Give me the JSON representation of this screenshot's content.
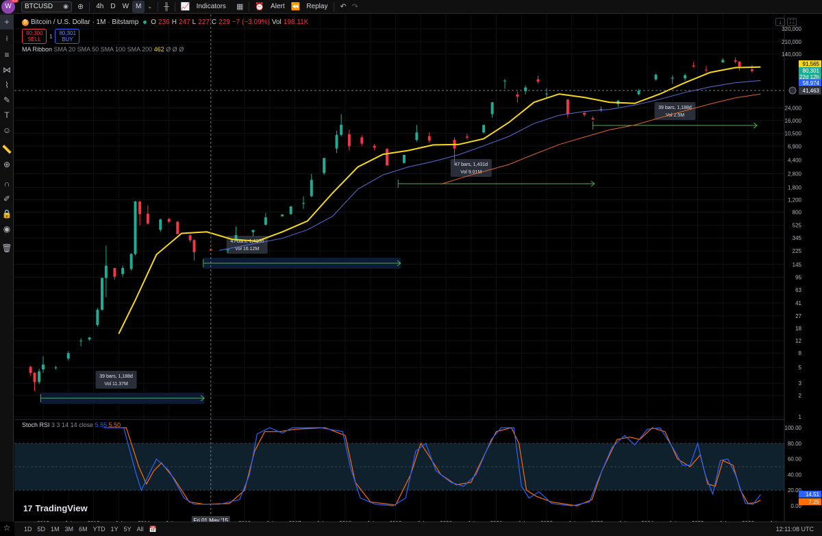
{
  "topbar": {
    "logo_letter": "W",
    "notification_count": "13",
    "symbol": "BTCUSD",
    "intervals": [
      "4h",
      "D",
      "W",
      "M"
    ],
    "active_interval": "M",
    "indicators_label": "Indicators",
    "alert_label": "Alert",
    "replay_label": "Replay"
  },
  "legend": {
    "title": "Bitcoin / U.S. Dollar · 1M · Bitstamp",
    "o_label": "O",
    "o_value": "236",
    "h_label": "H",
    "h_value": "247",
    "l_label": "L",
    "l_value": "227",
    "c_label": "C",
    "c_value": "229",
    "change": "−7 (−3.09%)",
    "vol_label": "Vol",
    "vol_value": "198.11K",
    "sell_price": "80,300",
    "sell_label": "SELL",
    "spread": "1",
    "buy_price": "80,301",
    "buy_label": "BUY"
  },
  "ribbon": {
    "name": "MA Ribbon",
    "params": "SMA 20 SMA 50 SMA 100 SMA 200",
    "value": "462",
    "zeros": "Ø Ø Ø"
  },
  "rsi": {
    "name": "Stoch RSI",
    "params": "3 3 14 14 close",
    "k_value": "5.55",
    "d_value": "5.50"
  },
  "price_axis": {
    "labels": [
      "320,000",
      "210,000",
      "140,000",
      "24,000",
      "16,000",
      "10,500",
      "6,900",
      "4,400",
      "2,800",
      "1,800",
      "1,200",
      "800",
      "525",
      "345",
      "225",
      "145",
      "95",
      "63",
      "41",
      "27",
      "18",
      "12",
      "8",
      "5",
      "3",
      "2",
      "1"
    ],
    "tags": {
      "sma_yellow": "91,565",
      "current_price": "80,301",
      "countdown": "22d 12h",
      "sma_blue": "58,974",
      "crosshair": "41,463"
    }
  },
  "rsi_axis": {
    "labels": [
      "100.00",
      "80.00",
      "60.00",
      "40.00",
      "20.00",
      "0.00"
    ],
    "tag_k": "14.51",
    "tag_d": "7.25"
  },
  "time_axis": {
    "labels": [
      "2012",
      "Jul",
      "2013",
      "Jul",
      "2014",
      "Jul",
      "2016",
      "Jul",
      "2017",
      "Jul",
      "2018",
      "Jul",
      "2019",
      "Jul",
      "2020",
      "Jul",
      "2021",
      "Jul",
      "2022",
      "Jul",
      "2023",
      "Jul",
      "2024",
      "Jul",
      "2025",
      "Jul",
      "2026",
      "Jul"
    ],
    "crosshair_date": "Fri 01 May '15"
  },
  "measures": [
    {
      "bars": "39 bars, 1,188d",
      "vol": "Vol 11.37M"
    },
    {
      "bars": "47 bars, 1,430d",
      "vol": "Vol 16.12M"
    },
    {
      "bars": "47 bars, 1,431d",
      "vol": "Vol 9.01M"
    },
    {
      "bars": "39 bars, 1,188d",
      "vol": "Vol 2.5M"
    }
  ],
  "brand": "TradingView",
  "bottom": {
    "ranges": [
      "1D",
      "5D",
      "1M",
      "3M",
      "6M",
      "YTD",
      "1Y",
      "5Y",
      "All"
    ],
    "clock": "12:11:08 UTC"
  },
  "colors": {
    "up": "#22ab94",
    "down": "#f23645",
    "sma20": "#f7d917",
    "sma50": "#5b6dd9",
    "sma100": "#e0662a",
    "stoch_k": "#2962ff",
    "stoch_d": "#ff6d00",
    "measure": "#4caf50"
  },
  "chart_data": {
    "type": "candlestick",
    "log_scale": true,
    "ylim": [
      1,
      320000
    ],
    "candles": [
      [
        2011.75,
        5.1,
        5.3,
        3.8,
        4.2
      ],
      [
        2011.83,
        4.2,
        4.3,
        2.3,
        3.1
      ],
      [
        2011.92,
        3.1,
        4.8,
        2.9,
        4.4
      ],
      [
        2012.0,
        4.7,
        7.2,
        4.2,
        5.5
      ],
      [
        2012.25,
        4.9,
        5.3,
        4.7,
        5.0
      ],
      [
        2012.5,
        6.7,
        8.5,
        6.3,
        8.0
      ],
      [
        2012.75,
        12.0,
        13.0,
        10.0,
        12.0
      ],
      [
        2012.92,
        12.5,
        13.5,
        12.0,
        13.3
      ],
      [
        2013.08,
        20.0,
        35.0,
        19.0,
        33.0
      ],
      [
        2013.17,
        33.0,
        95.0,
        32.0,
        93.0
      ],
      [
        2013.25,
        93.0,
        266.0,
        50.0,
        139.0
      ],
      [
        2013.42,
        129.0,
        130.0,
        88.0,
        97.0
      ],
      [
        2013.58,
        106.0,
        140.0,
        96.0,
        129.0
      ],
      [
        2013.75,
        125.0,
        210.0,
        118.0,
        204.0
      ],
      [
        2013.83,
        204.0,
        1160.0,
        195.0,
        1130.0
      ],
      [
        2013.92,
        1130.0,
        1165.0,
        520.0,
        750.0
      ],
      [
        2014.08,
        760.0,
        1000.0,
        540.0,
        550.0
      ],
      [
        2014.33,
        450.0,
        650.0,
        420.0,
        630.0
      ],
      [
        2014.5,
        640.0,
        660.0,
        560.0,
        585.0
      ],
      [
        2014.67,
        585.0,
        600.0,
        410.0,
        390.0
      ],
      [
        2014.92,
        375.0,
        390.0,
        300.0,
        320.0
      ],
      [
        2015.0,
        320.0,
        330.0,
        165.0,
        217.0
      ],
      [
        2015.33,
        236.0,
        247.0,
        227.0,
        229.0
      ],
      [
        2015.67,
        230.0,
        240.0,
        210.0,
        236.0
      ],
      [
        2015.83,
        310.0,
        500.0,
        300.0,
        378.0
      ],
      [
        2016.17,
        416.0,
        440.0,
        365.0,
        448.0
      ],
      [
        2016.42,
        530.0,
        780.0,
        520.0,
        675.0
      ],
      [
        2016.75,
        700.0,
        750.0,
        690.0,
        740.0
      ],
      [
        2016.92,
        750.0,
        980.0,
        740.0,
        963.0
      ],
      [
        2017.17,
        1080.0,
        1340.0,
        890.0,
        1080.0
      ],
      [
        2017.33,
        1350.0,
        2800.0,
        1300.0,
        2300.0
      ],
      [
        2017.58,
        2870.0,
        4700.0,
        2700.0,
        4700.0
      ],
      [
        2017.83,
        6400.0,
        11400.0,
        5500.0,
        10000.0
      ],
      [
        2017.92,
        10000.0,
        19700.0,
        9500.0,
        13900.0
      ],
      [
        2018.08,
        10200.0,
        11800.0,
        6000.0,
        6900.0
      ],
      [
        2018.33,
        9200.0,
        9900.0,
        7000.0,
        7500.0
      ],
      [
        2018.58,
        7000.0,
        7400.0,
        6000.0,
        6600.0
      ],
      [
        2018.83,
        6300.0,
        6500.0,
        3600.0,
        3700.0
      ],
      [
        2019.17,
        4000.0,
        5200.0,
        3900.0,
        5200.0
      ],
      [
        2019.42,
        8500.0,
        13800.0,
        8000.0,
        10800.0
      ],
      [
        2019.67,
        9600.0,
        10900.0,
        7700.0,
        8300.0
      ],
      [
        2020.17,
        8500.0,
        9200.0,
        3800.0,
        6400.0
      ],
      [
        2020.42,
        9450.0,
        10400.0,
        8600.0,
        9130.0
      ],
      [
        2020.75,
        10800.0,
        13900.0,
        10500.0,
        13800.0
      ],
      [
        2020.92,
        19700.0,
        29300.0,
        17600.0,
        29000.0
      ],
      [
        2021.17,
        58000.0,
        61800.0,
        45000.0,
        58800.0
      ],
      [
        2021.42,
        37300.0,
        41300.0,
        28800.0,
        35000.0
      ],
      [
        2021.58,
        41500.0,
        50500.0,
        37300.0,
        47100.0
      ],
      [
        2021.83,
        61300.0,
        69000.0,
        53000.0,
        57000.0
      ],
      [
        2022.0,
        38000.0,
        45800.0,
        32900.0,
        38400.0
      ],
      [
        2022.42,
        31800.0,
        31900.0,
        17600.0,
        19800.0
      ],
      [
        2022.75,
        20500.0,
        21000.0,
        18200.0,
        19400.0
      ],
      [
        2022.92,
        17200.0,
        18400.0,
        16300.0,
        16500.0
      ],
      [
        2023.08,
        23100.0,
        25200.0,
        21400.0,
        23200.0
      ],
      [
        2023.42,
        27200.0,
        31400.0,
        24800.0,
        30500.0
      ],
      [
        2023.83,
        37700.0,
        44700.0,
        36700.0,
        42200.0
      ],
      [
        2024.17,
        61100.0,
        73800.0,
        59000.0,
        71300.0
      ],
      [
        2024.5,
        62800.0,
        70000.0,
        53500.0,
        64600.0
      ],
      [
        2024.75,
        63300.0,
        73600.0,
        58800.0,
        70300.0
      ],
      [
        2024.92,
        96400.0,
        108300.0,
        90500.0,
        93400.0
      ],
      [
        2025.17,
        84300.0,
        95000.0,
        76600.0,
        82500.0
      ],
      [
        2025.5,
        107000.0,
        123000.0,
        105000.0,
        115700.0
      ],
      [
        2025.75,
        114000.0,
        126000.0,
        103000.0,
        109500.0
      ],
      [
        2025.83,
        109500.0,
        111000.0,
        82000.0,
        90500.0
      ],
      [
        2026.08,
        85000.0,
        98000.0,
        76000.0,
        80300.0
      ]
    ],
    "sma20": [
      [
        2013.5,
        15
      ],
      [
        2013.83,
        45
      ],
      [
        2014.25,
        200
      ],
      [
        2014.75,
        400
      ],
      [
        2015.25,
        420
      ],
      [
        2015.75,
        330
      ],
      [
        2016.25,
        310
      ],
      [
        2016.75,
        420
      ],
      [
        2017.25,
        600
      ],
      [
        2017.75,
        1500
      ],
      [
        2018.25,
        3500
      ],
      [
        2018.75,
        5300
      ],
      [
        2019.25,
        6000
      ],
      [
        2019.75,
        7200
      ],
      [
        2020.25,
        7300
      ],
      [
        2020.75,
        8800
      ],
      [
        2021.25,
        15000
      ],
      [
        2021.75,
        29000
      ],
      [
        2022.25,
        38000
      ],
      [
        2022.75,
        34000
      ],
      [
        2023.25,
        29000
      ],
      [
        2023.75,
        28000
      ],
      [
        2024.25,
        38000
      ],
      [
        2024.75,
        55000
      ],
      [
        2025.25,
        77000
      ],
      [
        2025.75,
        90000
      ],
      [
        2026.25,
        92000
      ]
    ],
    "sma50": [
      [
        2015.5,
        230
      ],
      [
        2016.25,
        290
      ],
      [
        2016.75,
        340
      ],
      [
        2017.25,
        450
      ],
      [
        2017.75,
        700
      ],
      [
        2018.25,
        1700
      ],
      [
        2018.75,
        2700
      ],
      [
        2019.25,
        3500
      ],
      [
        2019.75,
        4200
      ],
      [
        2020.25,
        5200
      ],
      [
        2020.75,
        7000
      ],
      [
        2021.25,
        9500
      ],
      [
        2021.75,
        14500
      ],
      [
        2022.25,
        19000
      ],
      [
        2022.75,
        21500
      ],
      [
        2023.25,
        23000
      ],
      [
        2023.75,
        26500
      ],
      [
        2024.25,
        32000
      ],
      [
        2024.75,
        40000
      ],
      [
        2025.25,
        48000
      ],
      [
        2025.75,
        55000
      ],
      [
        2026.25,
        59000
      ]
    ],
    "sma100": [
      [
        2019.9,
        2000
      ],
      [
        2020.5,
        2700
      ],
      [
        2021.25,
        3800
      ],
      [
        2021.75,
        5300
      ],
      [
        2022.25,
        7300
      ],
      [
        2022.75,
        9300
      ],
      [
        2023.25,
        11800
      ],
      [
        2023.75,
        13800
      ],
      [
        2024.25,
        17500
      ],
      [
        2024.75,
        22000
      ],
      [
        2025.25,
        27500
      ],
      [
        2025.75,
        33500
      ],
      [
        2026.25,
        38000
      ]
    ],
    "stoch_k": [
      [
        2013.2,
        100
      ],
      [
        2013.6,
        100
      ],
      [
        2013.85,
        40
      ],
      [
        2013.95,
        20
      ],
      [
        2014.1,
        40
      ],
      [
        2014.25,
        60
      ],
      [
        2014.5,
        45
      ],
      [
        2014.8,
        10
      ],
      [
        2015.0,
        2
      ],
      [
        2015.5,
        2
      ],
      [
        2015.9,
        8
      ],
      [
        2016.1,
        40
      ],
      [
        2016.25,
        92
      ],
      [
        2016.5,
        100
      ],
      [
        2016.75,
        93
      ],
      [
        2016.95,
        100
      ],
      [
        2017.5,
        100
      ],
      [
        2017.95,
        95
      ],
      [
        2018.1,
        50
      ],
      [
        2018.3,
        10
      ],
      [
        2018.6,
        2
      ],
      [
        2018.95,
        0
      ],
      [
        2019.2,
        10
      ],
      [
        2019.4,
        70
      ],
      [
        2019.6,
        80
      ],
      [
        2019.8,
        45
      ],
      [
        2020.1,
        30
      ],
      [
        2020.35,
        25
      ],
      [
        2020.6,
        40
      ],
      [
        2020.9,
        85
      ],
      [
        2021.1,
        100
      ],
      [
        2021.35,
        100
      ],
      [
        2021.5,
        25
      ],
      [
        2021.65,
        10
      ],
      [
        2021.85,
        18
      ],
      [
        2022.1,
        3
      ],
      [
        2022.5,
        0
      ],
      [
        2022.85,
        5
      ],
      [
        2023.0,
        30
      ],
      [
        2023.3,
        75
      ],
      [
        2023.55,
        90
      ],
      [
        2023.75,
        78
      ],
      [
        2024.0,
        98
      ],
      [
        2024.25,
        100
      ],
      [
        2024.5,
        75
      ],
      [
        2024.7,
        52
      ],
      [
        2024.85,
        52
      ],
      [
        2025.0,
        80
      ],
      [
        2025.15,
        40
      ],
      [
        2025.3,
        15
      ],
      [
        2025.45,
        58
      ],
      [
        2025.6,
        60
      ],
      [
        2025.75,
        40
      ],
      [
        2025.95,
        3
      ],
      [
        2026.1,
        2
      ],
      [
        2026.25,
        14.51
      ]
    ],
    "stoch_d": [
      [
        2013.3,
        100
      ],
      [
        2013.65,
        100
      ],
      [
        2013.9,
        50
      ],
      [
        2014.05,
        28
      ],
      [
        2014.2,
        45
      ],
      [
        2014.35,
        55
      ],
      [
        2014.6,
        35
      ],
      [
        2014.9,
        5
      ],
      [
        2015.2,
        2
      ],
      [
        2015.7,
        3
      ],
      [
        2016.0,
        20
      ],
      [
        2016.2,
        70
      ],
      [
        2016.4,
        95
      ],
      [
        2016.7,
        95
      ],
      [
        2017.0,
        98
      ],
      [
        2017.6,
        100
      ],
      [
        2018.0,
        90
      ],
      [
        2018.2,
        30
      ],
      [
        2018.5,
        5
      ],
      [
        2019.0,
        1
      ],
      [
        2019.3,
        40
      ],
      [
        2019.5,
        80
      ],
      [
        2019.7,
        60
      ],
      [
        2019.9,
        40
      ],
      [
        2020.2,
        27
      ],
      [
        2020.5,
        30
      ],
      [
        2020.8,
        70
      ],
      [
        2021.0,
        95
      ],
      [
        2021.3,
        100
      ],
      [
        2021.45,
        80
      ],
      [
        2021.6,
        20
      ],
      [
        2021.8,
        12
      ],
      [
        2022.1,
        5
      ],
      [
        2022.6,
        0
      ],
      [
        2022.9,
        8
      ],
      [
        2023.1,
        45
      ],
      [
        2023.4,
        85
      ],
      [
        2023.65,
        88
      ],
      [
        2023.85,
        85
      ],
      [
        2024.1,
        100
      ],
      [
        2024.35,
        95
      ],
      [
        2024.6,
        60
      ],
      [
        2024.85,
        50
      ],
      [
        2025.05,
        65
      ],
      [
        2025.2,
        28
      ],
      [
        2025.35,
        25
      ],
      [
        2025.5,
        58
      ],
      [
        2025.7,
        52
      ],
      [
        2025.85,
        20
      ],
      [
        2026.0,
        3
      ],
      [
        2026.15,
        4
      ],
      [
        2026.25,
        7.25
      ]
    ]
  }
}
